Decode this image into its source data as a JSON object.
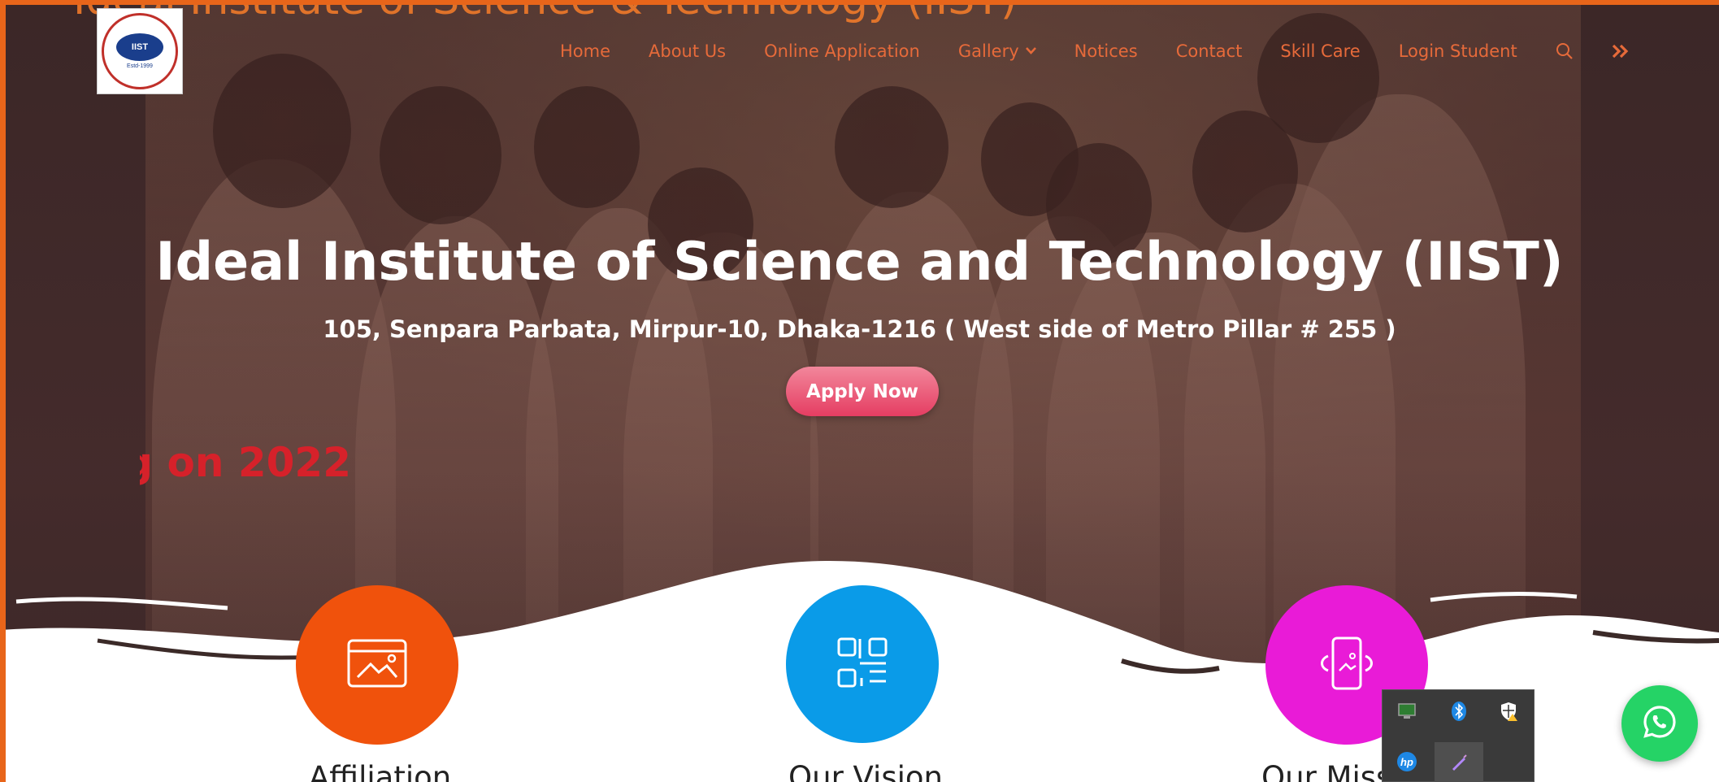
{
  "overlay_title": "Ideal Institute of Science & Technology (IIST)",
  "logo": {
    "alt": "Ideal Institute of Science & Technology",
    "text": "IIST",
    "est": "Estd-1999"
  },
  "nav": {
    "items": [
      "Home",
      "About Us",
      "Online Application",
      "Gallery",
      "Notices",
      "Contact",
      "Skill Care",
      "Login Student"
    ],
    "search_icon": "search-icon",
    "more_icon": "double-chevron-right-icon"
  },
  "hero": {
    "title": "Ideal Institute of Science and Technology (IIST)",
    "address": "105, Senpara Parbata, Mirpur-10, Dhaka-1216 ( West side of Metro Pillar # 255 )",
    "apply_label": "Apply Now",
    "marquee": "g on 2022"
  },
  "features": [
    {
      "title": "Affiliation",
      "color": "#f0520c",
      "icon": "image-frame-icon"
    },
    {
      "title": "Our Vision",
      "color": "#0a9be8",
      "icon": "qr-code-icon"
    },
    {
      "title": "Our Miss",
      "color": "#e91bd7",
      "icon": "phone-image-icon"
    }
  ],
  "colors": {
    "frame": "#e8651a",
    "nav_text": "#e66a3a",
    "apply_button": "#e53d62",
    "marquee": "#d6212a",
    "whatsapp": "#25d366"
  },
  "tray": {
    "icons": [
      "network-icon",
      "bluetooth-icon",
      "security-shield-icon",
      "hp-icon",
      "pen-icon"
    ]
  }
}
